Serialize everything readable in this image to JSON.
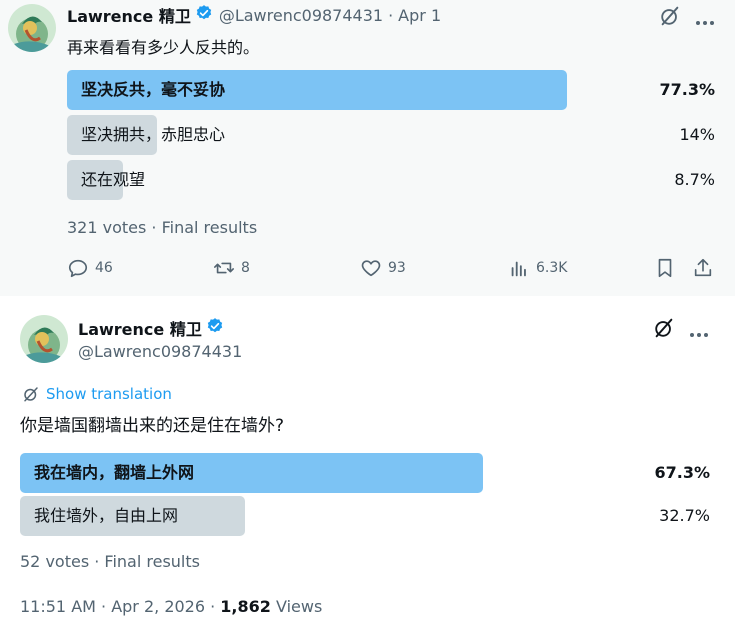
{
  "tweet1": {
    "name": "Lawrence 精卫",
    "handle": "@Lawrenc09874431",
    "separator": "·",
    "date": "Apr 1",
    "text": "再来看看有多少人反共的。",
    "poll": [
      {
        "label": "坚决反共，毫不妥协",
        "percent": "77.3%",
        "fraction": 0.773,
        "winner": true
      },
      {
        "label": "坚决拥共，赤胆忠心",
        "percent": "14%",
        "fraction": 0.14,
        "winner": false
      },
      {
        "label": "还在观望",
        "percent": "8.7%",
        "fraction": 0.087,
        "winner": false
      }
    ],
    "poll_meta": "321 votes · Final results",
    "actions": {
      "replies": "46",
      "reposts": "8",
      "likes": "93",
      "views": "6.3K"
    }
  },
  "tweet2": {
    "name": "Lawrence 精卫",
    "handle": "@Lawrenc09874431",
    "show_translation": "Show translation",
    "text": "你是墙国翻墙出来的还是住在墙外?",
    "poll": [
      {
        "label": "我在墙内，翻墙上外网",
        "percent": "67.3%",
        "fraction": 0.673,
        "winner": true
      },
      {
        "label": "我住墙外，自由上网",
        "percent": "32.7%",
        "fraction": 0.327,
        "winner": false
      }
    ],
    "poll_meta": "52 votes · Final results",
    "timestamp": "11:51 AM · Apr 2, 2026 · ",
    "views_count": "1,862",
    "views_label": " Views"
  },
  "colors": {
    "accent": "#1d9bf0",
    "winner_bar": "#7cc3f4",
    "other_bar": "#cfd9de",
    "muted": "#536471"
  }
}
